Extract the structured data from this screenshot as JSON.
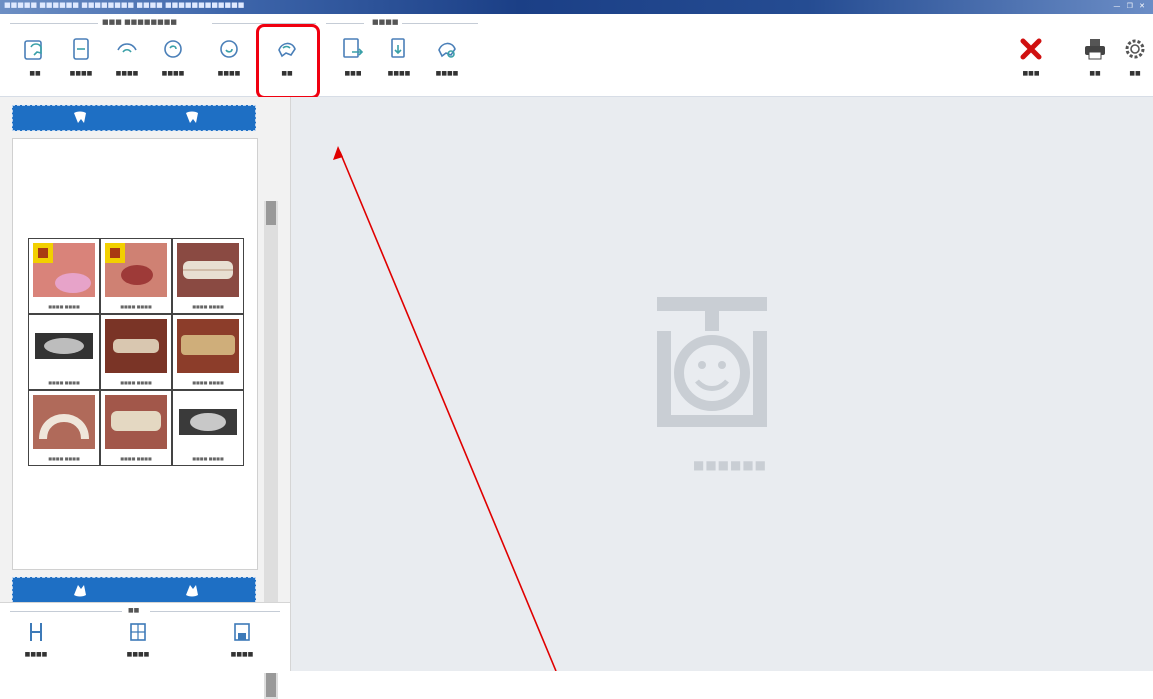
{
  "window": {
    "title": "■■■■■ ■■■■■■ ■■■■■■■■ ■■■■ ■■■■■■■■■■■■",
    "controls": "— ❐ ✕"
  },
  "ribbon": {
    "group1_title": "■■■ ■■■■■■■■",
    "group2_title": "■■■■",
    "buttons": [
      {
        "name": "btn-1",
        "label": "■■"
      },
      {
        "name": "btn-2",
        "label": "■■■■"
      },
      {
        "name": "btn-3",
        "label": "■■■■"
      },
      {
        "name": "btn-4",
        "label": "■■■■"
      },
      {
        "name": "btn-5",
        "label": "■■■■"
      },
      {
        "name": "btn-6",
        "label": "■■"
      },
      {
        "name": "btn-7",
        "label": "■■■"
      },
      {
        "name": "btn-8",
        "label": "■■■■"
      },
      {
        "name": "btn-9",
        "label": "■■■■"
      }
    ],
    "right_buttons": [
      {
        "name": "close",
        "label": "■■■"
      },
      {
        "name": "print",
        "label": "■■"
      },
      {
        "name": "settings",
        "label": "■■"
      }
    ]
  },
  "sidebar": {
    "thumb_captions": [
      "■■■■ ■■■■",
      "■■■■ ■■■■",
      "■■■■ ■■■■",
      "■■■■ ■■■■",
      "■■■■ ■■■■",
      "■■■■ ■■■■",
      "■■■■ ■■■■",
      "■■■■ ■■■■",
      "■■■■ ■■■■"
    ]
  },
  "footer": {
    "title": "■■",
    "buttons": [
      {
        "name": "f1",
        "label": "■■■■"
      },
      {
        "name": "f2",
        "label": "■■■■"
      },
      {
        "name": "f3",
        "label": "■■■■"
      }
    ]
  },
  "viewer": {
    "logo_caption": "■■■■■■"
  },
  "colors": {
    "accent": "#1e6fc4",
    "highlight": "#f00010",
    "logo": "#c9ced4",
    "close_red": "#d01010"
  }
}
